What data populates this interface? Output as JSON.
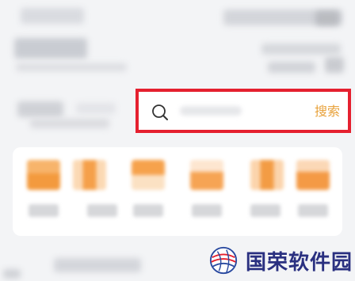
{
  "search": {
    "button_label": "搜索"
  },
  "watermark": {
    "text": "国荣软件园",
    "colors": {
      "text": "#2a3080",
      "globe_blue": "#2a4aa0",
      "globe_red": "#e5202f"
    }
  },
  "colors": {
    "highlight_border": "#e5202f",
    "search_button": "#e8a23b"
  }
}
